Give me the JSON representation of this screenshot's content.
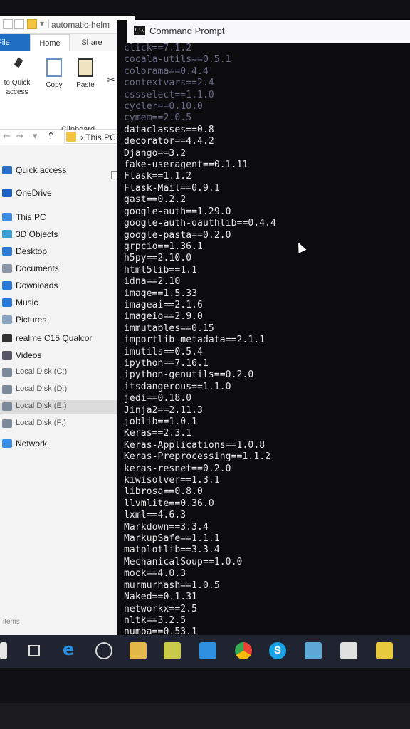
{
  "explorer": {
    "window_title": "automatic-helm",
    "tabs": {
      "file": "File",
      "home": "Home",
      "share": "Share"
    },
    "ribbon": {
      "pin_label": "to Quick\naccess",
      "copy_label": "Copy",
      "paste_label": "Paste",
      "group_label": "Clipboard"
    },
    "address": {
      "path": "This PC"
    },
    "nav_items": [
      {
        "label": "Quick access",
        "icon": "star-icon",
        "color": "#2a6fc9"
      },
      {
        "label": "OneDrive",
        "icon": "cloud-icon",
        "color": "#1a64c8"
      },
      {
        "label": "This PC",
        "icon": "computer-icon",
        "color": "#3a8ee6"
      },
      {
        "label": "3D Objects",
        "icon": "cube-icon",
        "color": "#3aa0d8"
      },
      {
        "label": "Desktop",
        "icon": "desktop-icon",
        "color": "#2a7bd6"
      },
      {
        "label": "Documents",
        "icon": "document-icon",
        "color": "#8a96a8"
      },
      {
        "label": "Downloads",
        "icon": "download-icon",
        "color": "#2a78d6"
      },
      {
        "label": "Music",
        "icon": "music-icon",
        "color": "#2a78d6"
      },
      {
        "label": "Pictures",
        "icon": "picture-icon",
        "color": "#8aa3c0"
      },
      {
        "label": "realme C15 Qualcor",
        "icon": "phone-icon",
        "color": "#333333"
      },
      {
        "label": "Videos",
        "icon": "video-icon",
        "color": "#555566"
      },
      {
        "label": "Local Disk (C:)",
        "icon": "disk-icon",
        "color": "#7a8a9a"
      },
      {
        "label": "Local Disk (D:)",
        "icon": "disk-icon",
        "color": "#7a8a9a"
      },
      {
        "label": "Local Disk (E:)",
        "icon": "disk-icon",
        "color": "#7a8a9a"
      },
      {
        "label": "Local Disk (F:)",
        "icon": "disk-icon",
        "color": "#7a8a9a"
      },
      {
        "label": "Network",
        "icon": "network-icon",
        "color": "#3a8ee6"
      }
    ],
    "selected_index": 13,
    "status": "items"
  },
  "cmd": {
    "title": "Command Prompt",
    "icon_text": "C:\\",
    "lines": [
      "click==7.1.2",
      "cocala-utils==0.5.1",
      "colorama==0.4.4",
      "contextvars==2.4",
      "cssselect==1.1.0",
      "cycler==0.10.0",
      "cymem==2.0.5",
      "dataclasses==0.8",
      "decorator==4.4.2",
      "Django==3.2",
      "fake-useragent==0.1.11",
      "Flask==1.1.2",
      "Flask-Mail==0.9.1",
      "gast==0.2.2",
      "google-auth==1.29.0",
      "google-auth-oauthlib==0.4.4",
      "google-pasta==0.2.0",
      "grpcio==1.36.1",
      "h5py==2.10.0",
      "html5lib==1.1",
      "idna==2.10",
      "image==1.5.33",
      "imageai==2.1.6",
      "imageio==2.9.0",
      "immutables==0.15",
      "importlib-metadata==2.1.1",
      "imutils==0.5.4",
      "ipython==7.16.1",
      "ipython-genutils==0.2.0",
      "itsdangerous==1.1.0",
      "jedi==0.18.0",
      "Jinja2==2.11.3",
      "joblib==1.0.1",
      "Keras==2.3.1",
      "Keras-Applications==1.0.8",
      "Keras-Preprocessing==1.1.2",
      "keras-resnet==0.2.0",
      "kiwisolver==1.3.1",
      "librosa==0.8.0",
      "llvmlite==0.36.0",
      "lxml==4.6.3",
      "Markdown==3.3.4",
      "MarkupSafe==1.1.1",
      "matplotlib==3.3.4",
      "MechanicalSoup==1.0.0",
      "mock==4.0.3",
      "murmurhash==1.0.5",
      "Naked==0.1.31",
      "networkx==2.5",
      "nltk==3.2.5",
      "numba==0.53.1"
    ],
    "faded_count": 7
  },
  "taskbar": {
    "items": [
      "start-icon",
      "task-view-icon",
      "edge-icon",
      "media-player-icon",
      "file-explorer-icon",
      "sticky-notes-icon",
      "vscode-icon",
      "chrome-icon",
      "skype-icon",
      "mail-icon",
      "feedback-icon",
      "notes-icon"
    ],
    "skype_glyph": "S"
  }
}
